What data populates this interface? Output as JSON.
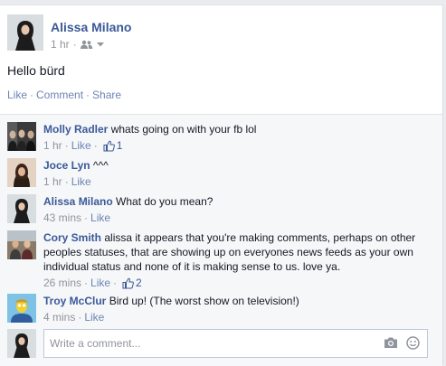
{
  "post": {
    "author": "Alissa Milano",
    "time": "1 hr",
    "audience_icon": "friends-icon",
    "text": "Hello bürd",
    "actions": {
      "like": "Like",
      "comment": "Comment",
      "share": "Share",
      "separator": "·"
    }
  },
  "comments": [
    {
      "name": "Molly Radler",
      "text": "whats going on with your fb lol",
      "time": "1 hr",
      "like": "Like",
      "likes": "1"
    },
    {
      "name": "Joce Lyn",
      "text": "^^^",
      "time": "1 hr",
      "like": "Like"
    },
    {
      "name": "Alissa Milano",
      "text": "What do you mean?",
      "time": "43 mins",
      "like": "Like"
    },
    {
      "name": "Cory Smith",
      "text": "alissa it appears that you're making comments, perhaps on other peoples statuses, that are showing up on everyones news feeds as your own individual status and none of it is making sense to us. love ya.",
      "time": "26 mins",
      "like": "Like",
      "likes": "2"
    },
    {
      "name": "Troy McClur",
      "text": "Bird up! (The worst show on television!)",
      "time": "4 mins",
      "like": "Like"
    }
  ],
  "composer": {
    "placeholder": "Write a comment...",
    "photo_icon": "camera-icon",
    "emoji_icon": "smiley-icon"
  },
  "colors": {
    "link": "#3b5998",
    "muted": "#90949c",
    "action": "#6d84b4",
    "comment_bg": "#f6f7f9"
  }
}
